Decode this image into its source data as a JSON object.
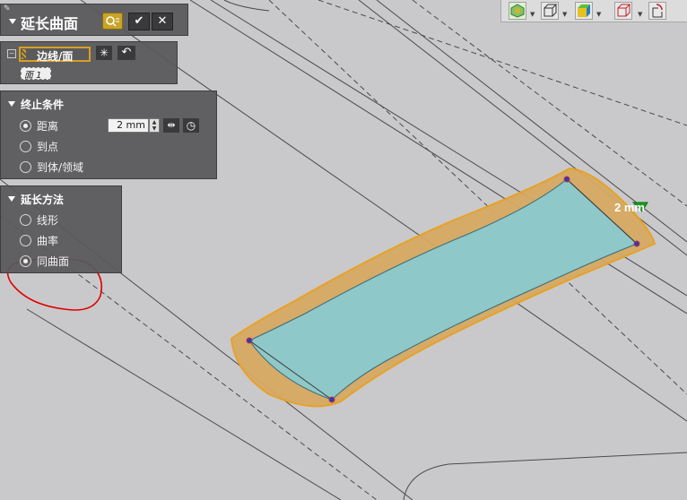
{
  "dialog": {
    "title": "延长曲面",
    "ok_glyph": "✔",
    "cancel_glyph": "✕",
    "selection": {
      "field_label": "边线/面",
      "list_item": "面 1"
    },
    "end_condition": {
      "header": "终止条件",
      "options": [
        "距离",
        "到点",
        "到体/领域"
      ],
      "selected_index": 0,
      "distance_value": "2 mm"
    },
    "extend_method": {
      "header": "延长方法",
      "options": [
        "线形",
        "曲率",
        "同曲面"
      ],
      "selected_index": 2
    }
  },
  "viewport": {
    "dimension_label": "2 mm",
    "surface_fill": "#8fc8c8",
    "extension_fill": "#d6aa62",
    "extension_edge": "#e8a020",
    "background": "#c9c9cb",
    "annotation_color": "#e00000"
  },
  "toolbar": {
    "icons": [
      "view-orient-icon",
      "box-view-icon",
      "shading-icon",
      "wireframe-view-icon",
      "section-view-icon"
    ]
  }
}
